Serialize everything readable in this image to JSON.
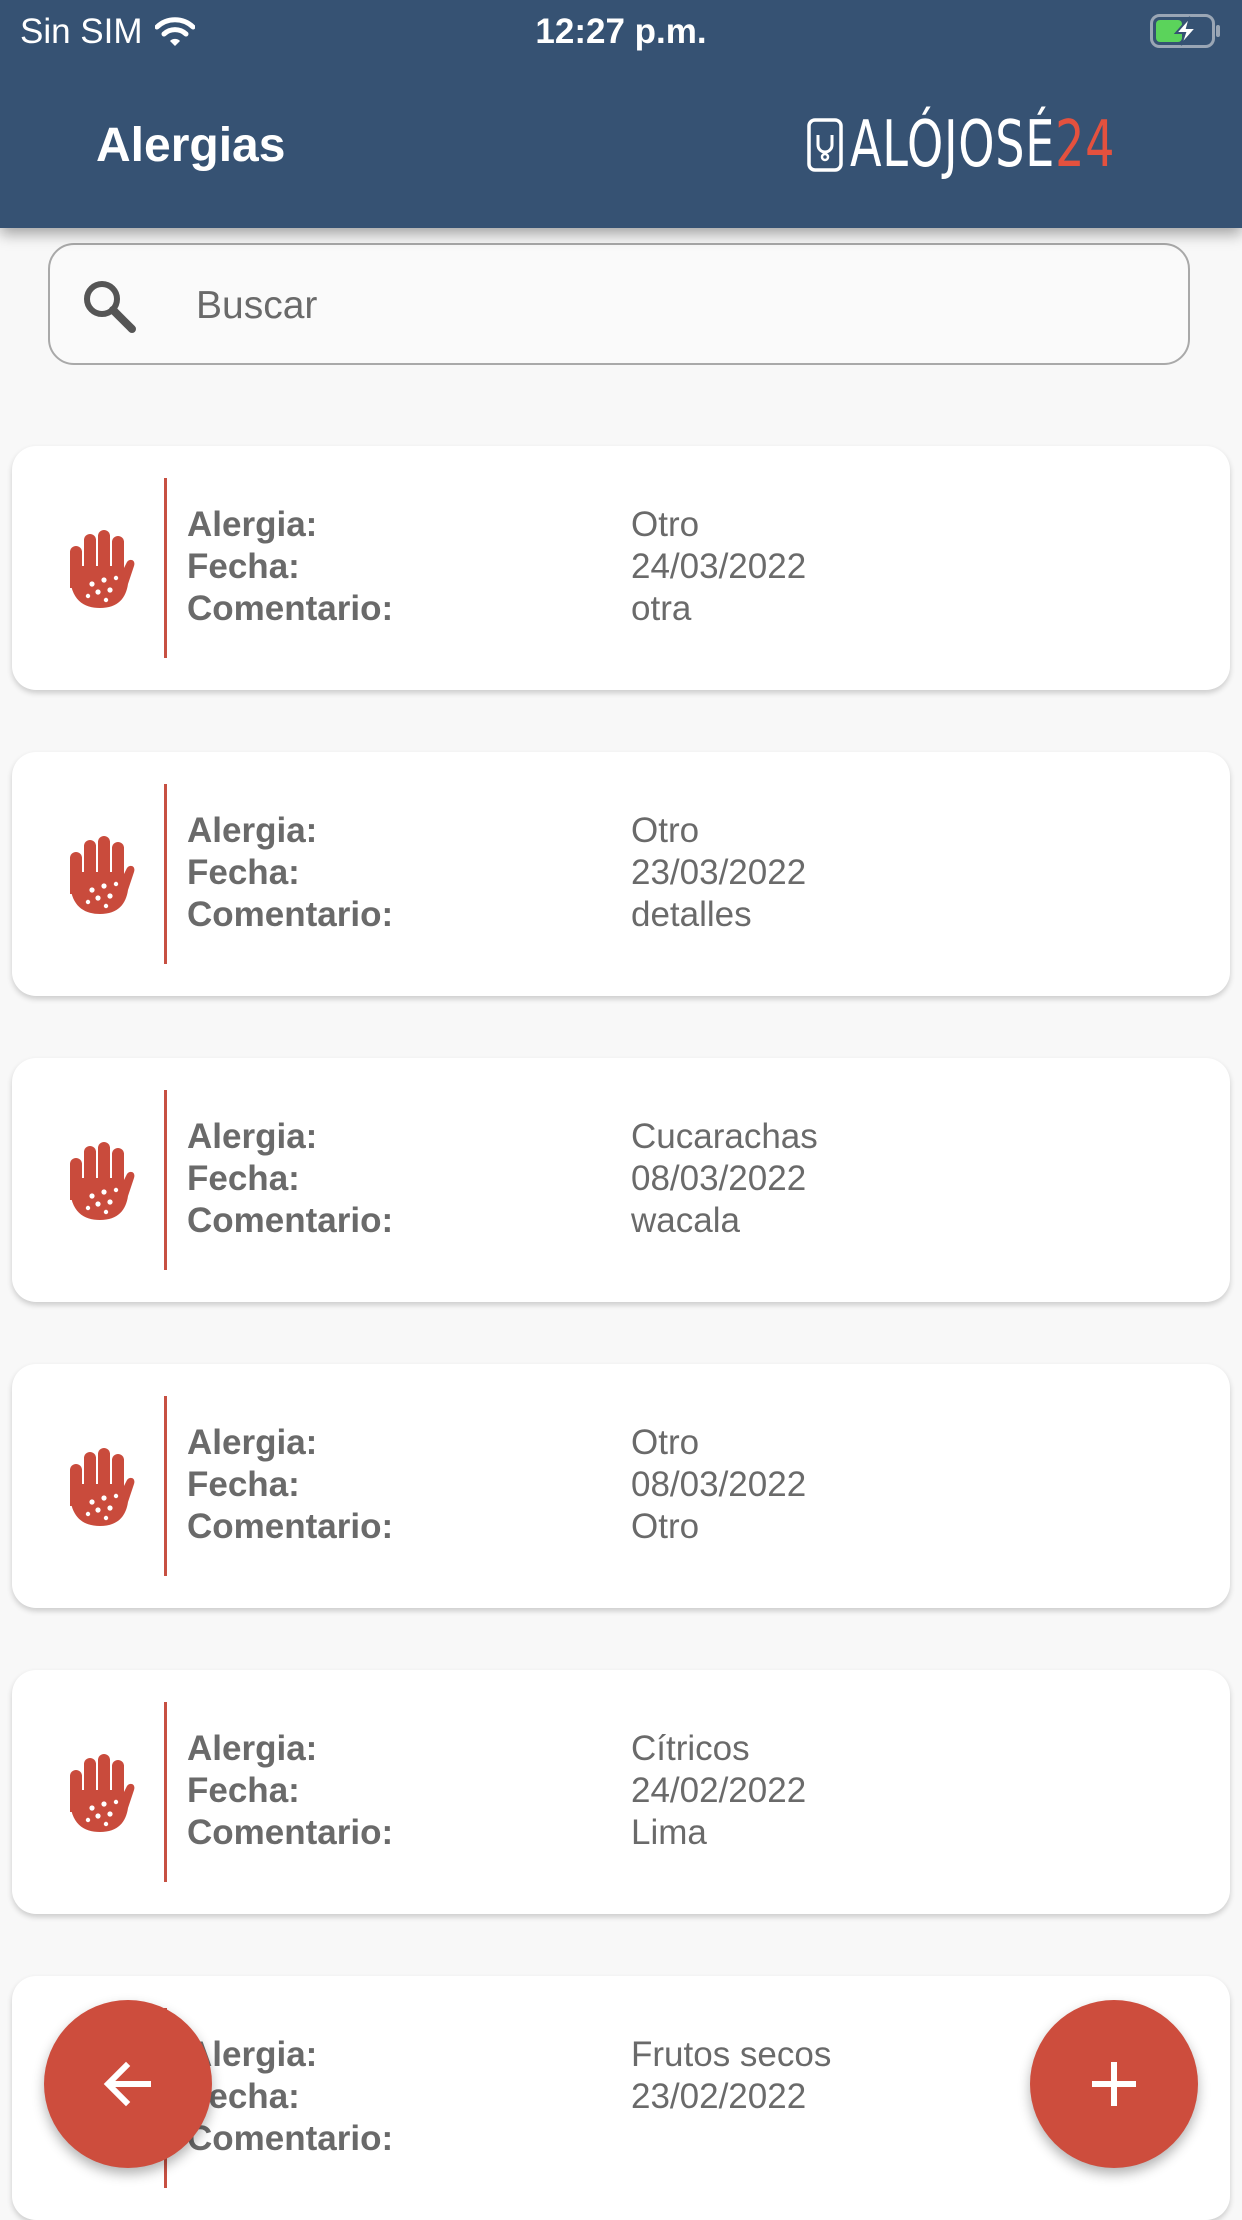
{
  "status_bar": {
    "carrier": "Sin SIM",
    "time": "12:27 p.m."
  },
  "header": {
    "title": "Alergias",
    "logo_main": "ALÓJOSÉ",
    "logo_number": "24"
  },
  "search": {
    "placeholder": "Buscar",
    "value": ""
  },
  "labels": {
    "allergy": "Alergia:",
    "date": "Fecha:",
    "comment": "Comentario:"
  },
  "allergies": [
    {
      "allergy": "Otro",
      "date": "24/03/2022",
      "comment": "otra"
    },
    {
      "allergy": "Otro",
      "date": "23/03/2022",
      "comment": "detalles"
    },
    {
      "allergy": "Cucarachas",
      "date": "08/03/2022",
      "comment": "wacala"
    },
    {
      "allergy": "Otro",
      "date": "08/03/2022",
      "comment": "Otro"
    },
    {
      "allergy": "Cítricos",
      "date": "24/02/2022",
      "comment": "Lima"
    },
    {
      "allergy": "Frutos secos",
      "date": "23/02/2022",
      "comment": ""
    }
  ],
  "colors": {
    "header_bg": "#365273",
    "accent": "#cd4d3d",
    "text": "#6a6a6a"
  },
  "icons": {
    "row_icon": "allergy-hand-icon",
    "back": "arrow-left-icon",
    "add": "plus-icon"
  }
}
